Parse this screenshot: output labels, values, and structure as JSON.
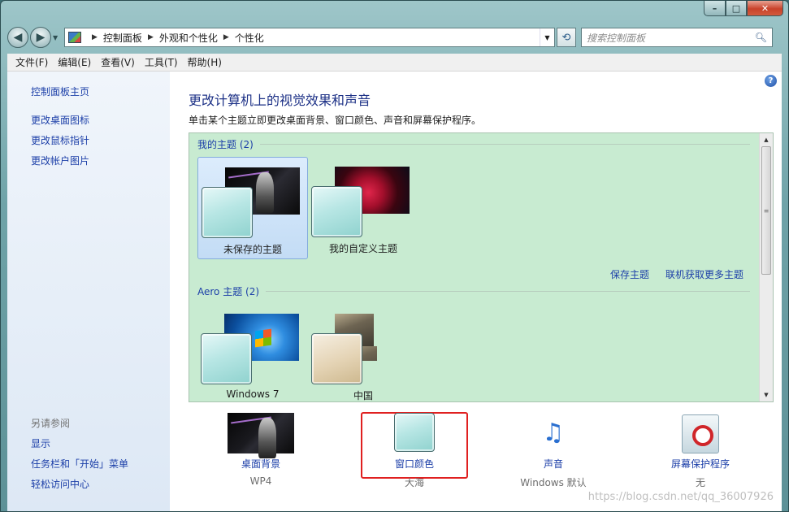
{
  "window": {
    "buttons": {
      "minimize": "–",
      "maximize": "□",
      "close": "✕"
    }
  },
  "nav": {
    "back": "◀",
    "forward": "▶",
    "breadcrumb": [
      "控制面板",
      "外观和个性化",
      "个性化"
    ],
    "search_placeholder": "搜索控制面板"
  },
  "menu": [
    "文件(F)",
    "编辑(E)",
    "查看(V)",
    "工具(T)",
    "帮助(H)"
  ],
  "sidebar": {
    "home": "控制面板主页",
    "links": [
      "更改桌面图标",
      "更改鼠标指针",
      "更改帐户图片"
    ],
    "see_also_title": "另请参阅",
    "see_also": [
      "显示",
      "任务栏和「开始」菜单",
      "轻松访问中心"
    ]
  },
  "main": {
    "title": "更改计算机上的视觉效果和声音",
    "subtitle": "单击某个主题立即更改桌面背景、窗口颜色、声音和屏幕保护程序。",
    "my_themes_header": "我的主题 (2)",
    "my_themes": [
      "未保存的主题",
      "我的自定义主题"
    ],
    "save_theme": "保存主题",
    "get_more": "联机获取更多主题",
    "aero_header": "Aero 主题 (2)",
    "aero_themes": [
      "Windows 7",
      "中国"
    ]
  },
  "bottom": [
    {
      "label": "桌面背景",
      "value": "WP4"
    },
    {
      "label": "窗口颜色",
      "value": "大海"
    },
    {
      "label": "声音",
      "value": "Windows 默认"
    },
    {
      "label": "屏幕保护程序",
      "value": "无"
    }
  ],
  "watermark": "https://blog.csdn.net/qq_36007926"
}
